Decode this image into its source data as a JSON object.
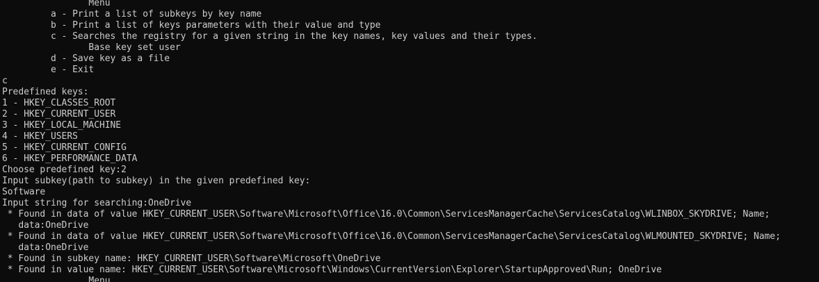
{
  "console": {
    "lines": [
      "                Menu",
      "         a - Print a list of subkeys by key name",
      "         b - Print a list of keys parameters with their value and type",
      "         c - Searches the registry for a given string in the key names, key values and their types.",
      "                Base key set user",
      "         d - Save key as a file",
      "         e - Exit",
      "c",
      "Predefined keys:",
      "1 - HKEY_CLASSES_ROOT",
      "2 - HKEY_CURRENT_USER",
      "3 - HKEY_LOCAL_MACHINE",
      "4 - HKEY_USERS",
      "5 - HKEY_CURRENT_CONFIG",
      "6 - HKEY_PERFORMANCE_DATA",
      "Choose predefined key:2",
      "Input subkey(path to subkey) in the given predefined key:",
      "Software",
      "Input string for searching:OneDrive",
      " * Found in data of value HKEY_CURRENT_USER\\Software\\Microsoft\\Office\\16.0\\Common\\ServicesManagerCache\\ServicesCatalog\\WLINBOX_SKYDRIVE; Name;",
      "   data:OneDrive",
      " * Found in data of value HKEY_CURRENT_USER\\Software\\Microsoft\\Office\\16.0\\Common\\ServicesManagerCache\\ServicesCatalog\\WLMOUNTED_SKYDRIVE; Name;",
      "   data:OneDrive",
      " * Found in subkey name: HKEY_CURRENT_USER\\Software\\Microsoft\\OneDrive",
      " * Found in value name: HKEY_CURRENT_USER\\Software\\Microsoft\\Windows\\CurrentVersion\\Explorer\\StartupApproved\\Run; OneDrive",
      "                Menu"
    ]
  },
  "colors": {
    "background": "#0c0c0c",
    "text": "#cccccc"
  }
}
